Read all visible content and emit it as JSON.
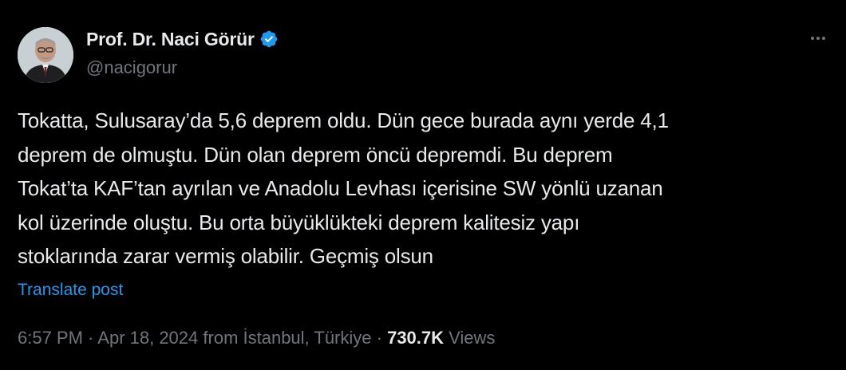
{
  "author": {
    "display_name": "Prof. Dr. Naci Görür",
    "handle": "@nacigorur",
    "verified": true,
    "avatar_icon": "profile-photo",
    "badge_color": "#1d9bf0"
  },
  "actions": {
    "more_icon": "ellipsis-icon"
  },
  "post": {
    "text": "Tokatta, Sulusaray’da 5,6 deprem oldu. Dün gece burada aynı yerde 4,1\ndeprem de olmuştu. Dün olan deprem öncü depremdi. Bu deprem\nTokat’ta KAF’tan ayrılan ve Anadolu Levhası içerisine SW yönlü uzanan\nkol üzerinde oluştu. Bu orta büyüklükteki deprem kalitesiz yapı\nstoklarında zarar vermiş olabilir. Geçmiş olsun",
    "translate_label": "Translate post"
  },
  "meta": {
    "time": "6:57 PM",
    "separator": " · ",
    "date": "Apr 18, 2024",
    "location": "from İstanbul, Türkiye",
    "views_count": "730.7K",
    "views_label": " Views"
  },
  "colors": {
    "background": "#000000",
    "text_primary": "#e7e9ea",
    "text_secondary": "#71767b",
    "accent": "#1d9bf0"
  }
}
